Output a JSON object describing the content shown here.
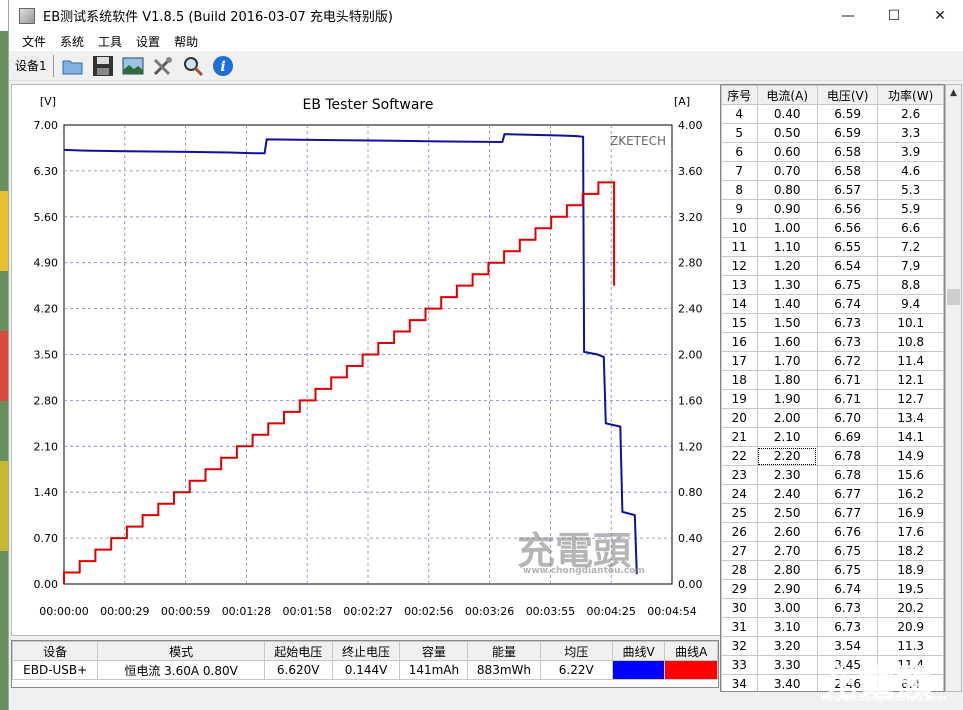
{
  "window": {
    "title": "EB测试系统软件 V1.8.5 (Build 2016-03-07 充电头特别版)",
    "minimize": "—",
    "maximize": "☐",
    "close": "✕"
  },
  "menu": [
    "文件",
    "系统",
    "工具",
    "设置",
    "帮助"
  ],
  "toolbar": {
    "device": "设备1",
    "icons": [
      "folder-icon",
      "save-icon",
      "picture-icon",
      "tools-icon",
      "zoom-icon",
      "info-icon"
    ]
  },
  "chart_data": {
    "type": "line",
    "title": "EB Tester Software",
    "watermark": "ZKETECH",
    "y_left_unit": "[V]",
    "y_right_unit": "[A]",
    "y_left_ticks": [
      "7.00",
      "6.30",
      "5.60",
      "4.90",
      "4.20",
      "3.50",
      "2.80",
      "2.10",
      "1.40",
      "0.70",
      "0.00"
    ],
    "y_right_ticks": [
      "4.00",
      "3.60",
      "3.20",
      "2.80",
      "2.40",
      "2.00",
      "1.60",
      "1.20",
      "0.80",
      "0.40",
      "0.00"
    ],
    "x_ticks": [
      "00:00:00",
      "00:00:29",
      "00:00:59",
      "00:01:28",
      "00:01:58",
      "00:02:27",
      "00:02:56",
      "00:03:26",
      "00:03:55",
      "00:04:25",
      "00:04:54"
    ],
    "ylim_left": [
      0,
      7
    ],
    "ylim_right": [
      0,
      4
    ],
    "xlim_seconds": [
      0,
      294
    ],
    "series": [
      {
        "color": "#1010a0",
        "axis": "left",
        "points": [
          [
            0,
            6.62
          ],
          [
            10,
            6.61
          ],
          [
            30,
            6.6
          ],
          [
            60,
            6.59
          ],
          [
            80,
            6.58
          ],
          [
            92,
            6.57
          ],
          [
            97,
            6.57
          ],
          [
            98,
            6.78
          ],
          [
            130,
            6.77
          ],
          [
            160,
            6.76
          ],
          [
            180,
            6.75
          ],
          [
            212,
            6.74
          ],
          [
            213,
            6.86
          ],
          [
            240,
            6.84
          ],
          [
            248,
            6.83
          ],
          [
            251,
            6.82
          ],
          [
            251.5,
            3.54
          ],
          [
            258,
            3.5
          ],
          [
            261,
            3.46
          ],
          [
            262,
            2.45
          ],
          [
            269,
            2.4
          ],
          [
            270,
            1.1
          ],
          [
            276,
            1.05
          ],
          [
            277,
            0.15
          ]
        ]
      },
      {
        "color": "#e00000",
        "axis": "right",
        "steps": [
          0.1,
          0.2,
          0.3,
          0.4,
          0.5,
          0.6,
          0.7,
          0.8,
          0.9,
          1.0,
          1.1,
          1.2,
          1.3,
          1.4,
          1.5,
          1.6,
          1.7,
          1.8,
          1.9,
          2.0,
          2.1,
          2.2,
          2.3,
          2.4,
          2.5,
          2.6,
          2.7,
          2.8,
          2.9,
          3.0,
          3.1,
          3.2,
          3.3,
          3.4,
          3.5
        ],
        "step_seconds": 7.6,
        "end_drop": 2.6
      }
    ]
  },
  "right_table": {
    "headers": [
      "序号",
      "电流(A)",
      "电压(V)",
      "功率(W)"
    ],
    "selected_row": 22,
    "rows": [
      [
        "4",
        "0.40",
        "6.59",
        "2.6"
      ],
      [
        "5",
        "0.50",
        "6.59",
        "3.3"
      ],
      [
        "6",
        "0.60",
        "6.58",
        "3.9"
      ],
      [
        "7",
        "0.70",
        "6.58",
        "4.6"
      ],
      [
        "8",
        "0.80",
        "6.57",
        "5.3"
      ],
      [
        "9",
        "0.90",
        "6.56",
        "5.9"
      ],
      [
        "10",
        "1.00",
        "6.56",
        "6.6"
      ],
      [
        "11",
        "1.10",
        "6.55",
        "7.2"
      ],
      [
        "12",
        "1.20",
        "6.54",
        "7.9"
      ],
      [
        "13",
        "1.30",
        "6.75",
        "8.8"
      ],
      [
        "14",
        "1.40",
        "6.74",
        "9.4"
      ],
      [
        "15",
        "1.50",
        "6.73",
        "10.1"
      ],
      [
        "16",
        "1.60",
        "6.73",
        "10.8"
      ],
      [
        "17",
        "1.70",
        "6.72",
        "11.4"
      ],
      [
        "18",
        "1.80",
        "6.71",
        "12.1"
      ],
      [
        "19",
        "1.90",
        "6.71",
        "12.7"
      ],
      [
        "20",
        "2.00",
        "6.70",
        "13.4"
      ],
      [
        "21",
        "2.10",
        "6.69",
        "14.1"
      ],
      [
        "22",
        "2.20",
        "6.78",
        "14.9"
      ],
      [
        "23",
        "2.30",
        "6.78",
        "15.6"
      ],
      [
        "24",
        "2.40",
        "6.77",
        "16.2"
      ],
      [
        "25",
        "2.50",
        "6.77",
        "16.9"
      ],
      [
        "26",
        "2.60",
        "6.76",
        "17.6"
      ],
      [
        "27",
        "2.70",
        "6.75",
        "18.2"
      ],
      [
        "28",
        "2.80",
        "6.75",
        "18.9"
      ],
      [
        "29",
        "2.90",
        "6.74",
        "19.5"
      ],
      [
        "30",
        "3.00",
        "6.73",
        "20.2"
      ],
      [
        "31",
        "3.10",
        "6.73",
        "20.9"
      ],
      [
        "32",
        "3.20",
        "3.54",
        "11.3"
      ],
      [
        "33",
        "3.30",
        "3.45",
        "11.4"
      ],
      [
        "34",
        "3.40",
        "2.46",
        "8.4"
      ]
    ]
  },
  "summary": {
    "headers": [
      "设备",
      "模式",
      "起始电压",
      "终止电压",
      "容量",
      "能量",
      "均压",
      "曲线V",
      "曲线A"
    ],
    "values": [
      "EBD-USB+",
      "恒电流  3.60A  0.80V",
      "6.620V",
      "0.144V",
      "141mAh",
      "883mWh",
      "6.22V",
      "",
      ""
    ]
  },
  "brand_watermark": "充電頭",
  "brand_url": "www.chongdiantou.com"
}
